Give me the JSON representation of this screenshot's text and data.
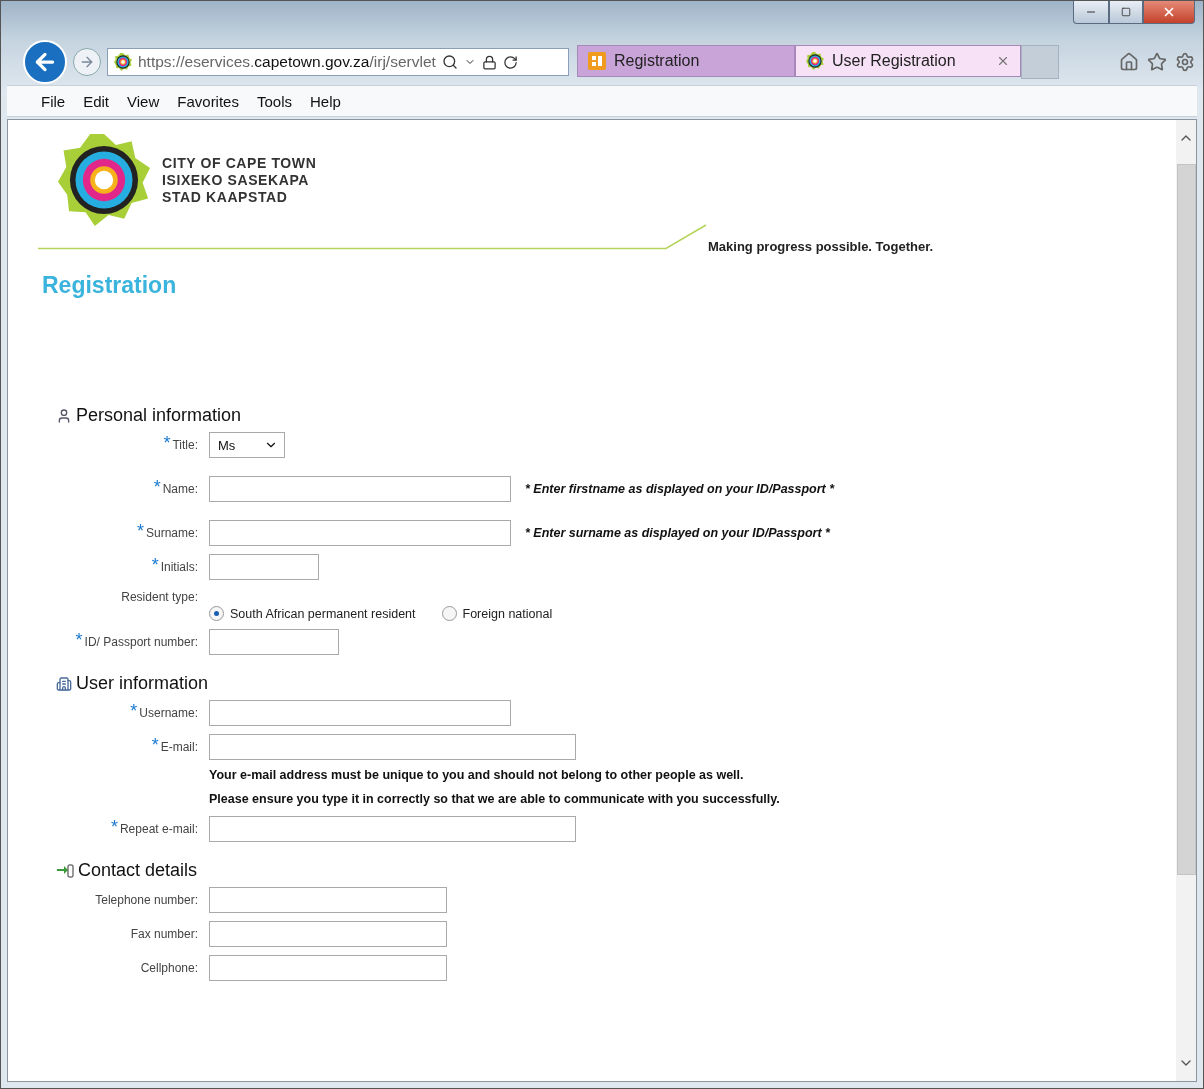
{
  "browser": {
    "url": [
      {
        "text": "https://",
        "strong": false
      },
      {
        "text": "eservices.",
        "strong": false
      },
      {
        "text": "capetown.gov.za",
        "strong": true
      },
      {
        "text": "/irj/servlet",
        "strong": false
      }
    ],
    "tabs": [
      {
        "label": "Registration",
        "selected": false
      },
      {
        "label": "User Registration",
        "selected": true
      }
    ],
    "menu": [
      "File",
      "Edit",
      "View",
      "Favorites",
      "Tools",
      "Help"
    ]
  },
  "header": {
    "logo_lines": [
      "CITY OF CAPE TOWN",
      "ISIXEKO SASEKAPA",
      "STAD KAAPSTAD"
    ],
    "tagline": "Making progress possible. Together.",
    "title": "Registration"
  },
  "sections": [
    {
      "title": "Personal information",
      "fields": [
        {
          "kind": "select",
          "label": "Title:",
          "marker": "*",
          "value": "Ms"
        },
        {
          "kind": "text",
          "label": "Name:",
          "marker": "*",
          "hint": "* Enter firstname as displayed on your ID/Passport *"
        },
        {
          "kind": "text",
          "label": "Surname:",
          "marker": "*",
          "hint": "* Enter surname as displayed on your ID/Passport *"
        },
        {
          "kind": "text",
          "label": "Initials:",
          "marker": "*"
        },
        {
          "kind": "radio",
          "label": "Resident type:",
          "options": [
            {
              "label": "South African permanent resident",
              "selected": true
            },
            {
              "label": "Foreign national",
              "selected": false
            }
          ]
        },
        {
          "kind": "text",
          "label": "ID/ Passport number:",
          "marker": "*"
        }
      ]
    },
    {
      "title": "User information",
      "fields": [
        {
          "kind": "text",
          "label": "Username:",
          "marker": "*"
        },
        {
          "kind": "text",
          "label": "E-mail:",
          "marker": "*",
          "note": [
            "Your e-mail address must be unique to you and should not belong to other people as well.",
            "Please ensure you type it in correctly so that we are able to communicate with you successfully."
          ]
        },
        {
          "kind": "text",
          "label": "Repeat e-mail:",
          "marker": "*"
        }
      ]
    },
    {
      "title": "Contact details",
      "fields": [
        {
          "kind": "text",
          "label": "Telephone number:"
        },
        {
          "kind": "text",
          "label": "Fax number:"
        },
        {
          "kind": "text",
          "label": "Cellphone:"
        }
      ]
    }
  ]
}
